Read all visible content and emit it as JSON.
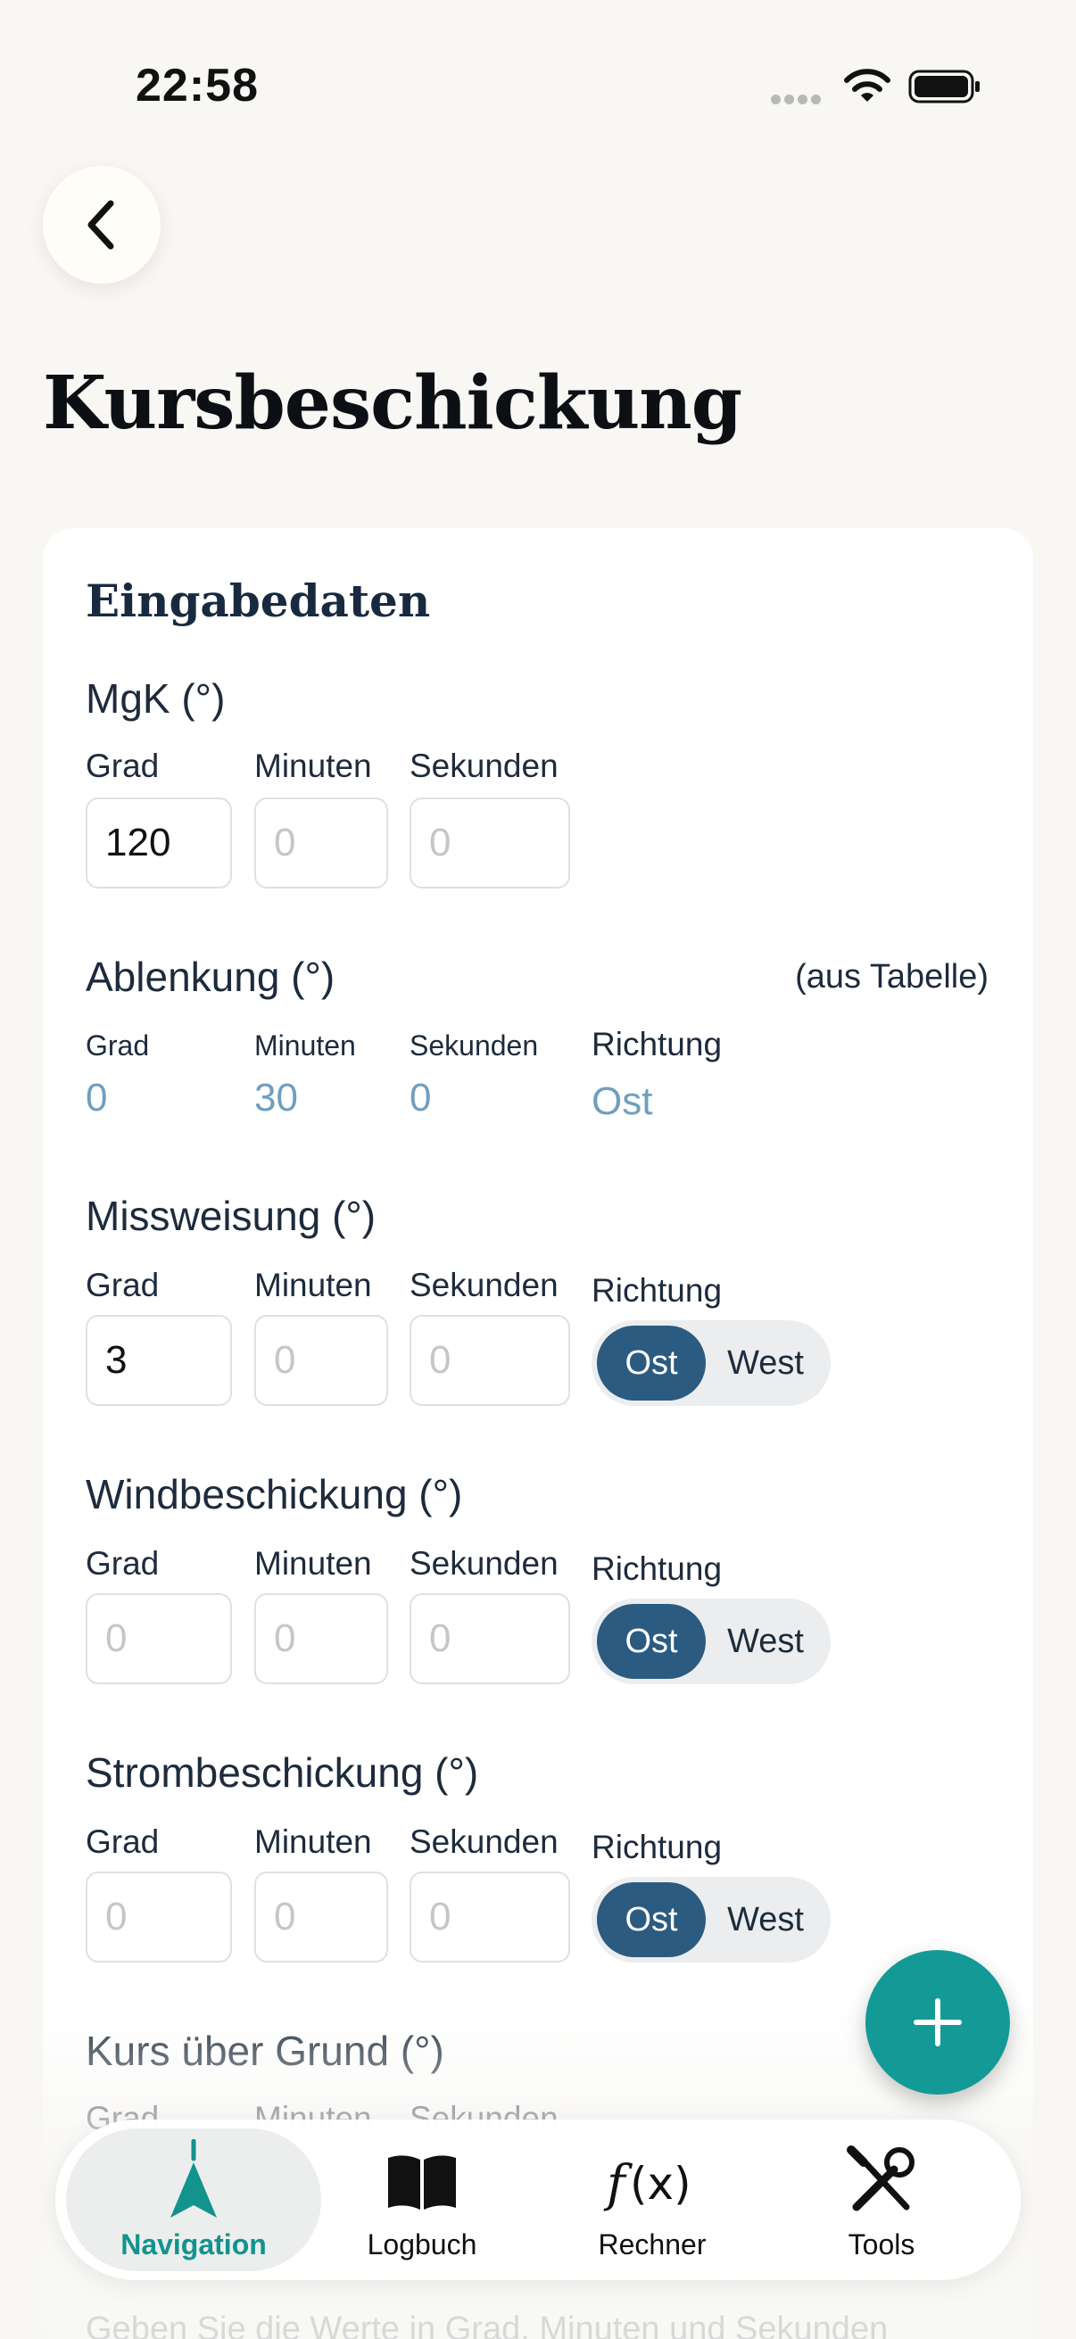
{
  "status": {
    "time": "22:58"
  },
  "header": {
    "title": "Kursbeschickung"
  },
  "card": {
    "title": "Eingabedaten",
    "mgk": {
      "title": "MgK (°)",
      "labels": {
        "grad": "Grad",
        "minuten": "Minuten",
        "sekunden": "Sekunden"
      },
      "values": {
        "grad": "120",
        "minuten": "",
        "sekunden": ""
      },
      "placeholders": {
        "grad": "0",
        "minuten": "0",
        "sekunden": "0"
      }
    },
    "ablenkung": {
      "title": "Ablenkung (°)",
      "note": "(aus Tabelle)",
      "labels": {
        "grad": "Grad",
        "minuten": "Minuten",
        "sekunden": "Sekunden",
        "richtung": "Richtung"
      },
      "values": {
        "grad": "0",
        "minuten": "30",
        "sekunden": "0",
        "richtung": "Ost"
      }
    },
    "missweisung": {
      "title": "Missweisung (°)",
      "labels": {
        "grad": "Grad",
        "minuten": "Minuten",
        "sekunden": "Sekunden",
        "richtung": "Richtung"
      },
      "values": {
        "grad": "3",
        "minuten": "",
        "sekunden": ""
      },
      "placeholders": {
        "grad": "0",
        "minuten": "0",
        "sekunden": "0"
      },
      "toggle": {
        "ost": "Ost",
        "west": "West",
        "selected": "Ost"
      }
    },
    "windbeschickung": {
      "title": "Windbeschickung (°)",
      "labels": {
        "grad": "Grad",
        "minuten": "Minuten",
        "sekunden": "Sekunden",
        "richtung": "Richtung"
      },
      "placeholders": {
        "grad": "0",
        "minuten": "0",
        "sekunden": "0"
      },
      "toggle": {
        "ost": "Ost",
        "west": "West",
        "selected": "Ost"
      }
    },
    "strombeschickung": {
      "title": "Strombeschickung (°)",
      "labels": {
        "grad": "Grad",
        "minuten": "Minuten",
        "sekunden": "Sekunden",
        "richtung": "Richtung"
      },
      "placeholders": {
        "grad": "0",
        "minuten": "0",
        "sekunden": "0"
      },
      "toggle": {
        "ost": "Ost",
        "west": "West",
        "selected": "Ost"
      }
    },
    "kug": {
      "title": "Kurs über Grund (°)",
      "labels": {
        "grad": "Grad",
        "minuten": "Minuten",
        "sekunden": "Sekunden"
      }
    },
    "footnote": "Geben Sie die Werte in Grad, Minuten und Sekunden"
  },
  "tabbar": {
    "items": [
      {
        "label": "Navigation",
        "icon": "navigation-arrow-icon",
        "active": true
      },
      {
        "label": "Logbuch",
        "icon": "book-icon",
        "active": false
      },
      {
        "label": "Rechner",
        "icon": "function-icon",
        "active": false
      },
      {
        "label": "Tools",
        "icon": "wrench-screwdriver-icon",
        "active": false
      }
    ]
  },
  "colors": {
    "accent": "#149a96",
    "toggle_active": "#2b5b80",
    "readonly_value": "#6f9fbf"
  }
}
